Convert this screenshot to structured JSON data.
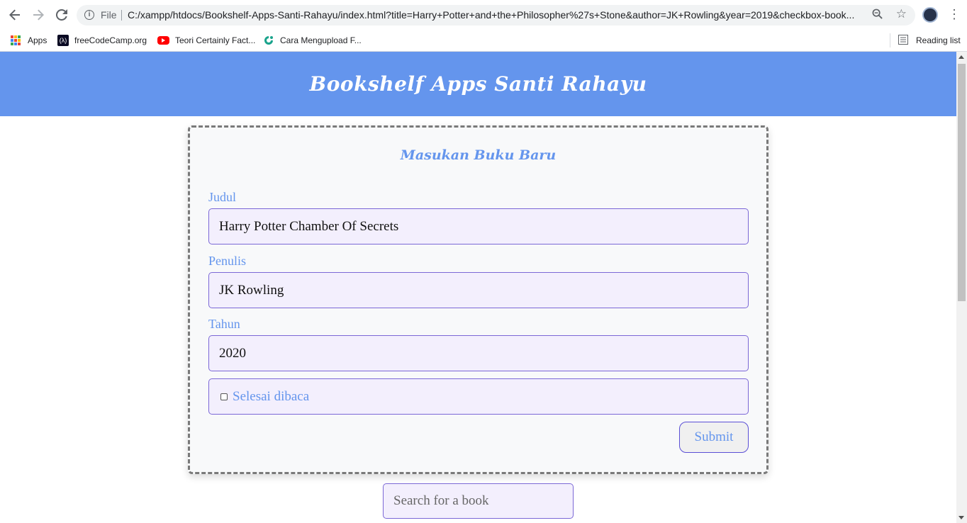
{
  "browser": {
    "file_label": "File",
    "url": "C:/xampp/htdocs/Bookshelf-Apps-Santi-Rahayu/index.html?title=Harry+Potter+and+the+Philosopher%27s+Stone&author=JK+Rowling&year=2019&checkbox-book...",
    "bookmarks": [
      {
        "label": "Apps",
        "icon": "apps-grid-icon"
      },
      {
        "label": "freeCodeCamp.org",
        "icon": "freecodecamp-icon"
      },
      {
        "label": "Teori Certainly Fact...",
        "icon": "youtube-icon"
      },
      {
        "label": "Cara Mengupload F...",
        "icon": "site-icon"
      }
    ],
    "reading_list": "Reading list"
  },
  "page": {
    "header_title": "Bookshelf Apps Santi Rahayu",
    "form": {
      "title": "Masukan Buku Baru",
      "judul_label": "Judul",
      "judul_value": "Harry Potter Chamber Of Secrets",
      "penulis_label": "Penulis",
      "penulis_value": "JK Rowling",
      "tahun_label": "Tahun",
      "tahun_value": "2020",
      "checkbox_label": "Selesai dibaca",
      "checkbox_checked": false,
      "submit_label": "Submit"
    },
    "search": {
      "placeholder": "Search for a book"
    }
  },
  "colors": {
    "header_bg": "#6495ed",
    "accent_text": "#6495ed",
    "field_bg": "#f3effd",
    "field_border": "#7b68d6"
  }
}
